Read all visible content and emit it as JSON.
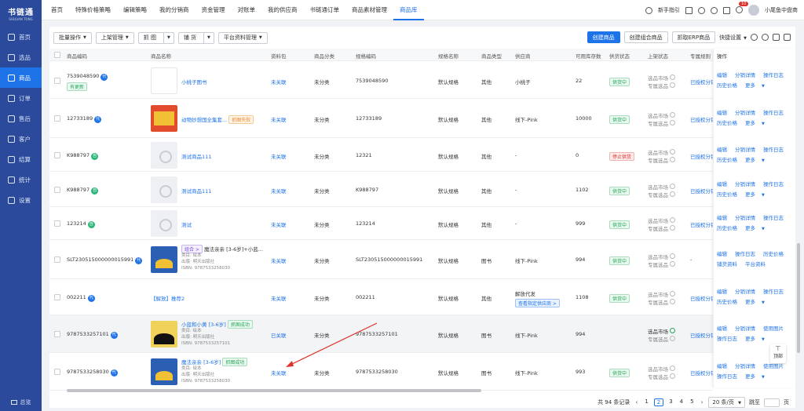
{
  "app": {
    "logo": "书链通",
    "logo_sub": "SHULIAN TONG"
  },
  "sidebar": {
    "items": [
      {
        "label": "首页",
        "icon": "home-icon"
      },
      {
        "label": "选品",
        "icon": "select-icon"
      },
      {
        "label": "商品",
        "icon": "goods-icon",
        "active": true
      },
      {
        "label": "订单",
        "icon": "order-icon"
      },
      {
        "label": "售后",
        "icon": "aftersale-icon"
      },
      {
        "label": "客户",
        "icon": "customer-icon"
      },
      {
        "label": "结算",
        "icon": "settle-icon"
      },
      {
        "label": "统计",
        "icon": "stats-icon"
      },
      {
        "label": "设置",
        "icon": "settings-icon"
      }
    ],
    "bottom": "总览"
  },
  "topnav": {
    "tabs": [
      "首页",
      "特殊价格策略",
      "编辑策略",
      "我的分销商",
      "资金管理",
      "对账单",
      "我的供应商",
      "书链通订单",
      "商品素材管理",
      "商品库"
    ],
    "active_index": 9,
    "right": {
      "guide": "新手指引",
      "notif_count": "10",
      "user": "小尾鱼中盘商"
    }
  },
  "toolbar": {
    "batch": "批量操作",
    "listing": "上架管理",
    "grab": "抓 图",
    "restock": "铺 货",
    "platform": "平台资料管理",
    "create": "创建商品",
    "create_combo": "创建组合商品",
    "grab_erp": "抓取ERP商品",
    "quick": "快捷设置"
  },
  "table": {
    "headers": [
      "商品编码",
      "商品名称",
      "资料包",
      "商品分类",
      "规格编码",
      "规格名称",
      "商品类型",
      "供应商",
      "可用库存数",
      "供货状态",
      "上架状态",
      "专属规则",
      "操作"
    ],
    "rows": [
      {
        "code": "7539048590",
        "tag": "代",
        "extra": "有更新",
        "name": "小桃子图书",
        "pack": "未关联",
        "cat": "未分类",
        "spec_code": "7539048590",
        "spec_name": "默认规格",
        "type": "其他",
        "supplier": "小桃子",
        "stock": "22",
        "status": "供货中",
        "shelf1": "选品市场",
        "shelf2": "专属选品",
        "rule": "已授权分销",
        "ops": [
          "编辑",
          "分销详情",
          "操作日志",
          "历史价格",
          "更多"
        ]
      },
      {
        "code": "12733189",
        "tag": "代",
        "name": "动物妙想国全集套...",
        "name_tag": "抓图失败",
        "pack": "未关联",
        "cat": "未分类",
        "spec_code": "12733189",
        "spec_name": "默认规格",
        "type": "其他",
        "supplier": "线下-Pink",
        "stock": "10000",
        "status": "供货中",
        "shelf1": "选品市场",
        "shelf2": "专属选品",
        "rule": "已授权分销",
        "ops": [
          "编辑",
          "分销详情",
          "操作日志",
          "历史价格",
          "更多"
        ]
      },
      {
        "code": "K988797",
        "tag": "自",
        "name": "测试商品111",
        "pack": "未关联",
        "cat": "未分类",
        "spec_code": "12321",
        "spec_name": "默认规格",
        "type": "其他",
        "supplier": "-",
        "stock": "0",
        "status": "停止供货",
        "shelf1": "选品市场",
        "shelf2": "专属选品",
        "rule": "已授权分销",
        "ops": [
          "编辑",
          "分销详情",
          "操作日志",
          "历史价格",
          "更多"
        ]
      },
      {
        "code": "K988797",
        "tag": "自",
        "name": "测试商品111",
        "pack": "未关联",
        "cat": "未分类",
        "spec_code": "K988797",
        "spec_name": "默认规格",
        "type": "其他",
        "supplier": "-",
        "stock": "1102",
        "status": "供货中",
        "shelf1": "选品市场",
        "shelf2": "专属选品",
        "rule": "已授权分销",
        "ops": [
          "编辑",
          "分销详情",
          "操作日志",
          "历史价格",
          "更多"
        ]
      },
      {
        "code": "123214",
        "tag": "自",
        "name": "测试",
        "pack": "未关联",
        "cat": "未分类",
        "spec_code": "123214",
        "spec_name": "默认规格",
        "type": "其他",
        "supplier": "-",
        "stock": "999",
        "status": "供货中",
        "shelf1": "选品市场",
        "shelf2": "专属选品",
        "rule": "已授权分销",
        "ops": [
          "编辑",
          "分销详情",
          "操作日志",
          "历史价格",
          "更多"
        ]
      },
      {
        "code": "SLT230515000000015991",
        "tag": "代",
        "name": "魔法亲亲 [3-6岁]+小蓝...",
        "name_tag": "组合 >",
        "author": "类目: 绘本",
        "publisher": "出版: 明天出版社",
        "isbn": "ISBN: 9787533258030",
        "pack": "未关联",
        "cat": "未分类",
        "spec_code": "SLT230515000000015991",
        "spec_name": "默认规格",
        "type": "图书",
        "supplier": "线下-Pink",
        "stock": "994",
        "status": "供货中",
        "shelf1": "选品市场",
        "shelf2": "专属选品",
        "rule": "-",
        "ops": [
          "编辑",
          "操作日志",
          "历史价格",
          "铺货资料",
          "平台资料"
        ]
      },
      {
        "code": "002211",
        "tag": "代",
        "name": "【解放】推荐2",
        "pack": "未关联",
        "cat": "未分类",
        "spec_code": "002211",
        "spec_name": "默认规格",
        "type": "其他",
        "supplier": "解放代发",
        "supplier_btn": "查看指定供应商 >",
        "stock": "1108",
        "status": "供货中",
        "shelf1": "选品市场",
        "shelf2": "专属选品",
        "rule": "已授权分销",
        "ops": [
          "编辑",
          "分销详情",
          "操作日志",
          "历史价格",
          "更多"
        ]
      },
      {
        "code": "9787533257101",
        "tag": "代",
        "name": "小蓝和小黄 [3-6岁]",
        "name_tag": "抓图成功",
        "author": "类目: 绘本",
        "publisher": "出版: 明天出版社",
        "isbn": "ISBN: 9787533257101",
        "pack": "已关联",
        "cat": "未分类",
        "spec_code": "9787533257101",
        "spec_name": "默认规格",
        "type": "图书",
        "supplier": "线下-Pink",
        "stock": "994",
        "status": "",
        "shelf1": "选品市场",
        "shelf2": "专属选品",
        "rule": "已授权分销",
        "ops": [
          "编辑",
          "分销详情",
          "使用图片",
          "操作日志",
          "更多"
        ]
      },
      {
        "code": "9787533258030",
        "tag": "代",
        "name": "魔法亲亲 [3-6岁]",
        "name_tag": "抓图成功",
        "author": "类目: 绘本",
        "publisher": "出版: 明天出版社",
        "isbn": "ISBN: 9787533258030",
        "pack": "未关联",
        "cat": "未分类",
        "spec_code": "9787533258030",
        "spec_name": "默认规格",
        "type": "图书",
        "supplier": "线下-Pink",
        "stock": "993",
        "status": "供货中",
        "shelf1": "选品市场",
        "shelf2": "专属选品",
        "rule": "已授权分销",
        "ops": [
          "编辑",
          "分销详情",
          "使用图片",
          "操作日志",
          "更多"
        ]
      }
    ]
  },
  "pager": {
    "total": "共 94 条记录",
    "pages": [
      "1",
      "2",
      "3",
      "4",
      "5"
    ],
    "active": "2",
    "size": "20 条/页",
    "goto": "跳至",
    "page_unit": "页"
  },
  "totop": "顶部",
  "colors": {
    "primary": "#1e73e8",
    "sidebar": "#2b4a9c",
    "annotation": "#e0312b"
  }
}
